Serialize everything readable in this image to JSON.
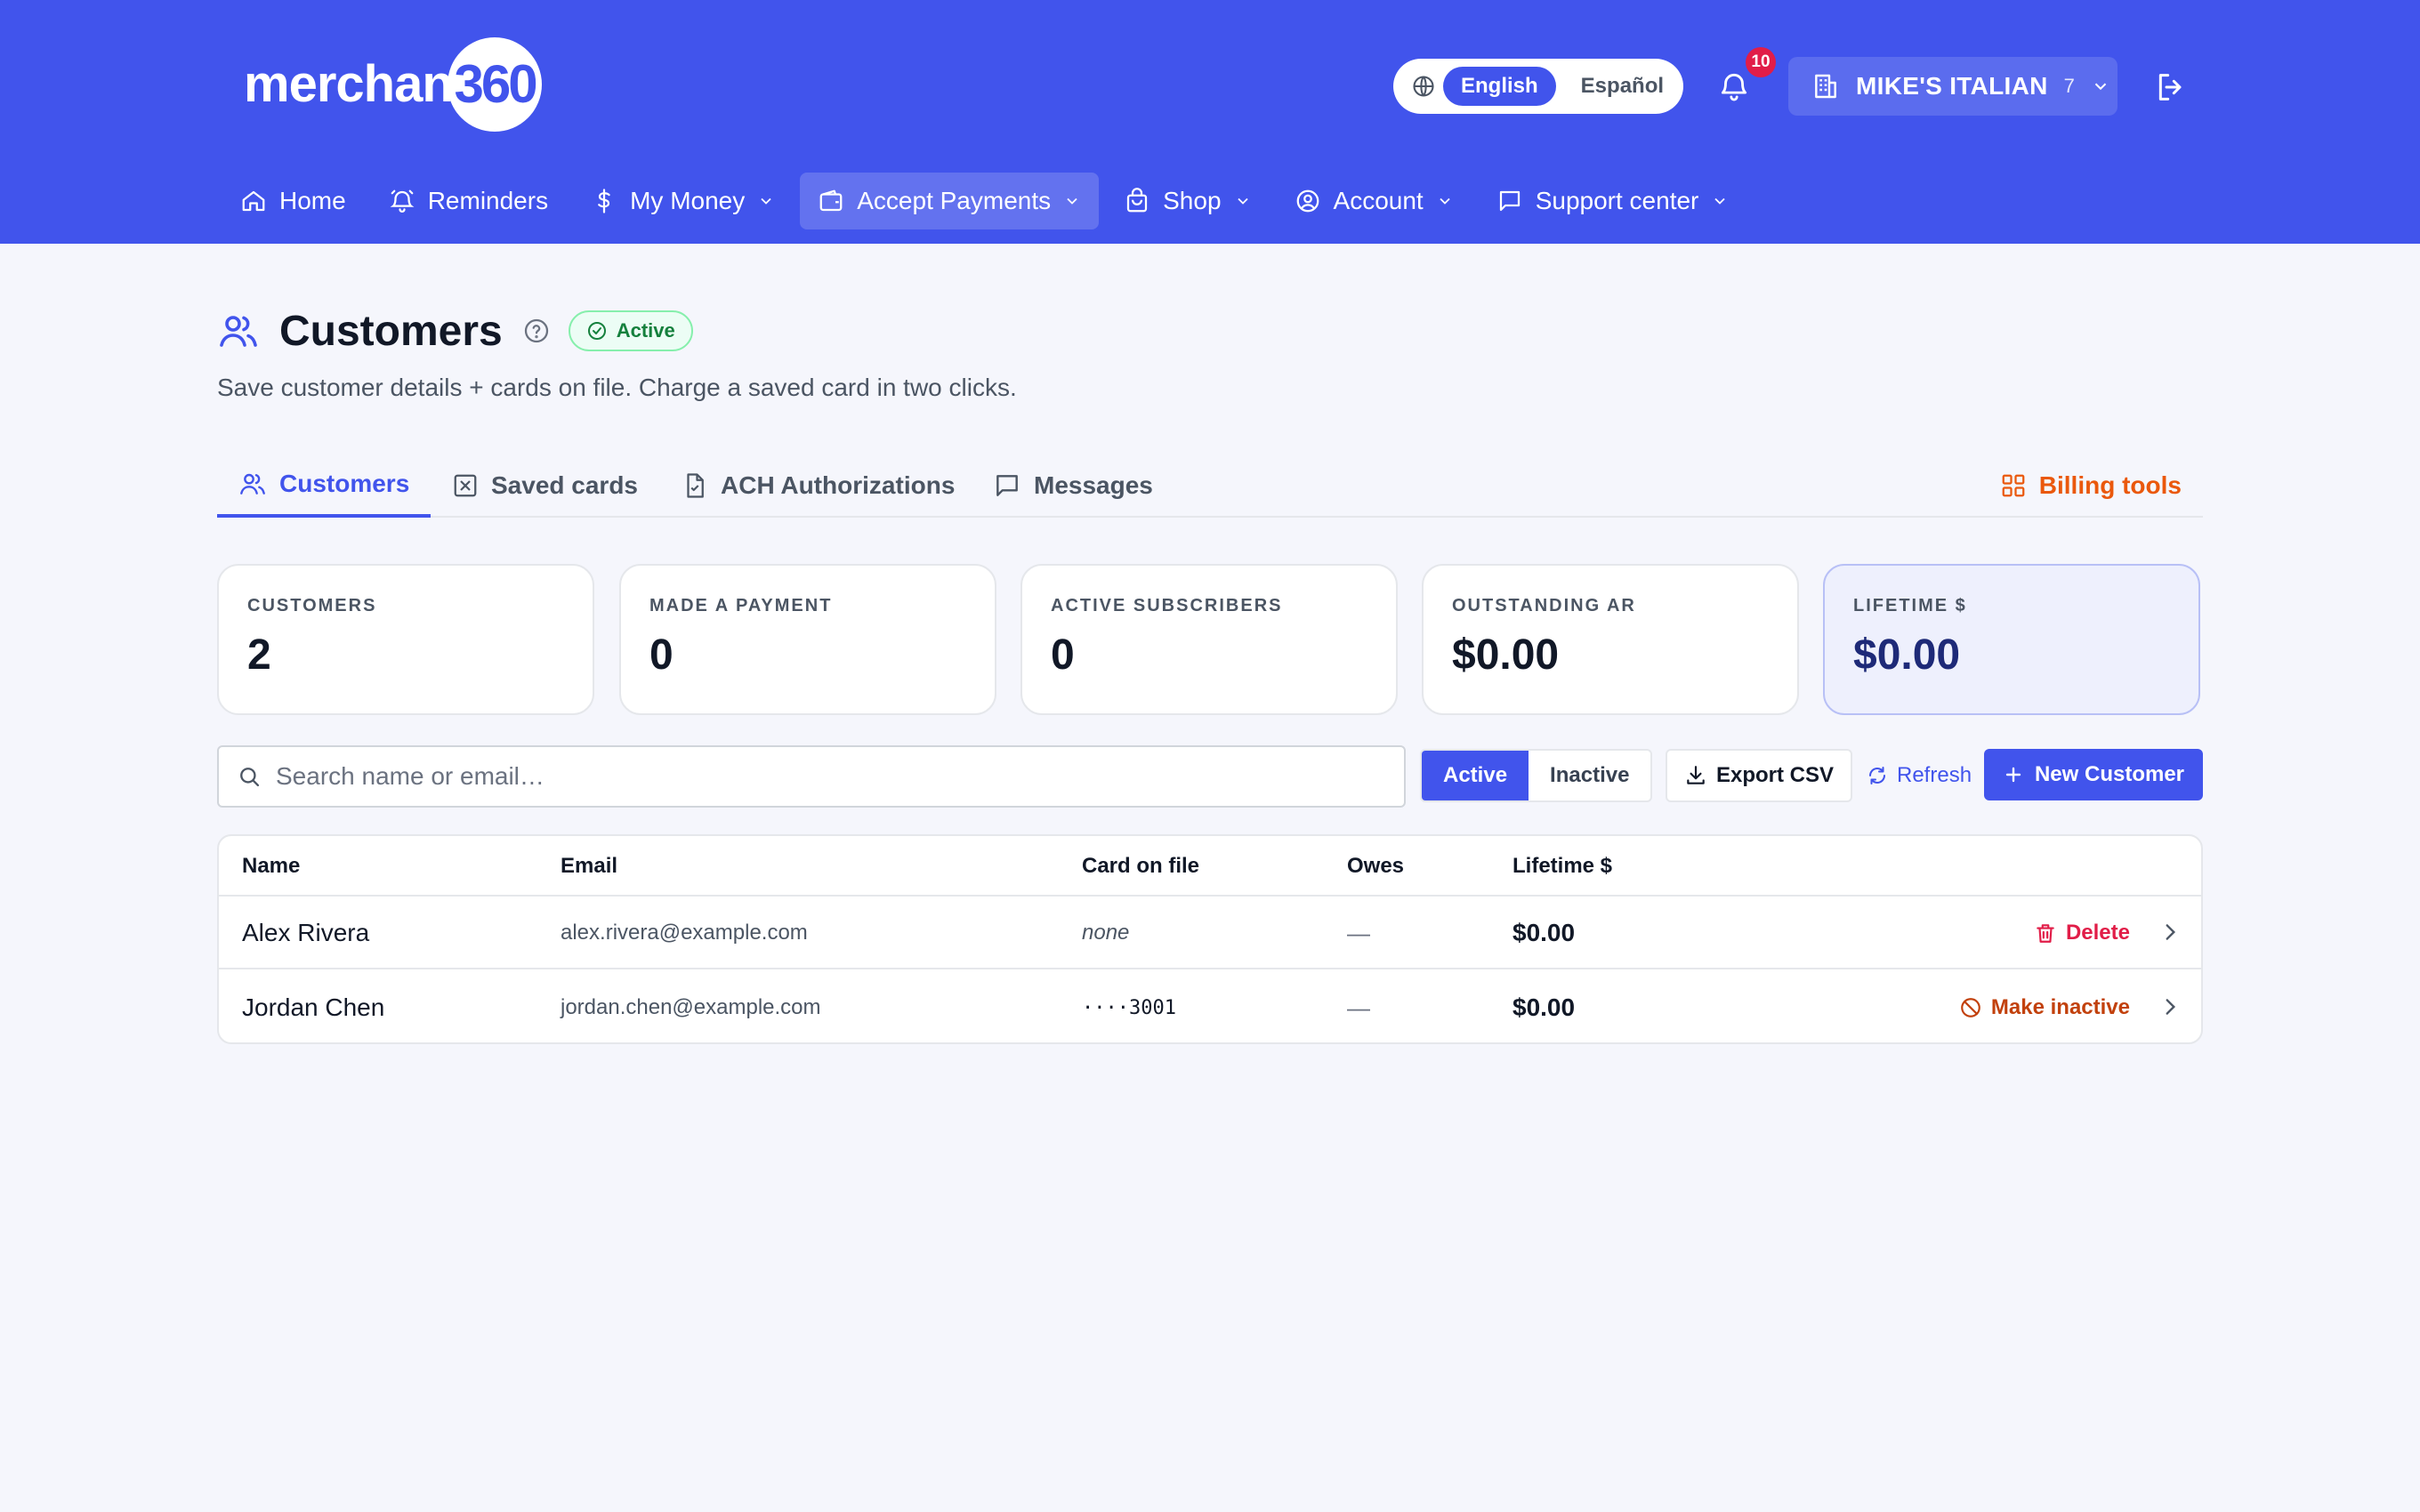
{
  "header": {
    "logo_text": "merchant",
    "logo_number": "360",
    "languages": [
      "English",
      "Español"
    ],
    "active_language": "English",
    "notifications_count": "10",
    "merchant_name": "MIKE'S ITALIAN",
    "merchant_count": "7",
    "brand_color": "#4154ec"
  },
  "nav": {
    "items": [
      {
        "label": "Home",
        "icon": "home-icon"
      },
      {
        "label": "Reminders",
        "icon": "bell-icon"
      },
      {
        "label": "My Money",
        "icon": "dollar-icon",
        "has_menu": true
      },
      {
        "label": "Accept Payments",
        "icon": "wallet-icon",
        "has_menu": true,
        "active": true
      },
      {
        "label": "Shop",
        "icon": "shopping-bag-icon",
        "has_menu": true
      },
      {
        "label": "Account",
        "icon": "user-circle-icon",
        "has_menu": true
      },
      {
        "label": "Support center",
        "icon": "message-icon",
        "has_menu": true
      }
    ]
  },
  "page": {
    "title": "Customers",
    "status": "Active",
    "subtitle": "Save customer details + cards on file. Charge a saved card in two clicks."
  },
  "tabs": {
    "items": [
      "Customers",
      "Saved cards",
      "ACH Authorizations",
      "Messages"
    ],
    "active": "Customers",
    "billing_tools": "Billing tools"
  },
  "stats": [
    {
      "label": "CUSTOMERS",
      "value": "2"
    },
    {
      "label": "MADE A PAYMENT",
      "value": "0"
    },
    {
      "label": "ACTIVE SUBSCRIBERS",
      "value": "0"
    },
    {
      "label": "OUTSTANDING AR",
      "value": "$0.00"
    },
    {
      "label": "LIFETIME $",
      "value": "$0.00"
    }
  ],
  "toolbar": {
    "search_placeholder": "Search name or email…",
    "filter_active": "Active",
    "filter_inactive": "Inactive",
    "export_label": "Export CSV",
    "refresh_label": "Refresh",
    "new_label": "New Customer"
  },
  "table": {
    "columns": [
      "Name",
      "Email",
      "Card on file",
      "Owes",
      "Lifetime $"
    ],
    "rows": [
      {
        "name": "Alex Rivera",
        "email": "alex.rivera@example.com",
        "card": "none",
        "owes": "—",
        "lifetime": "$0.00",
        "action": "Delete"
      },
      {
        "name": "Jordan Chen",
        "email": "jordan.chen@example.com",
        "card": "····3001",
        "owes": "—",
        "lifetime": "$0.00",
        "action": "Make inactive"
      }
    ]
  }
}
